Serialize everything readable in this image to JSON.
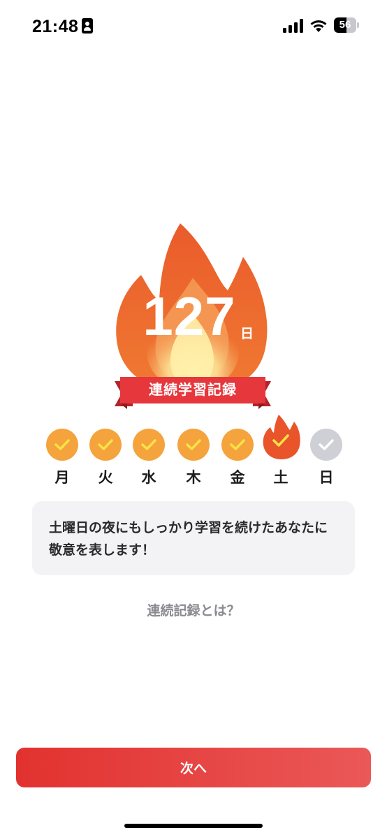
{
  "status_bar": {
    "time": "21:48",
    "battery_level": "56",
    "battery_fraction": 0.56
  },
  "streak": {
    "count": "127",
    "unit": "日",
    "badge_label": "連続学習記録",
    "flame_color": "#ea5b2b"
  },
  "week": {
    "days": [
      {
        "label": "月",
        "state": "done"
      },
      {
        "label": "火",
        "state": "done"
      },
      {
        "label": "水",
        "state": "done"
      },
      {
        "label": "木",
        "state": "done"
      },
      {
        "label": "金",
        "state": "done"
      },
      {
        "label": "土",
        "state": "today"
      },
      {
        "label": "日",
        "state": "missed"
      }
    ],
    "check_color": "#f8e346",
    "done_color": "#f5a33c",
    "missed_color": "#cfcfd6"
  },
  "message": {
    "text": "土曜日の夜にもしっかり学習を続けたあなたに敬意を表します！"
  },
  "about_link": "連続記録とは？",
  "next_button": {
    "label": "次へ",
    "color": "#e2322f"
  }
}
